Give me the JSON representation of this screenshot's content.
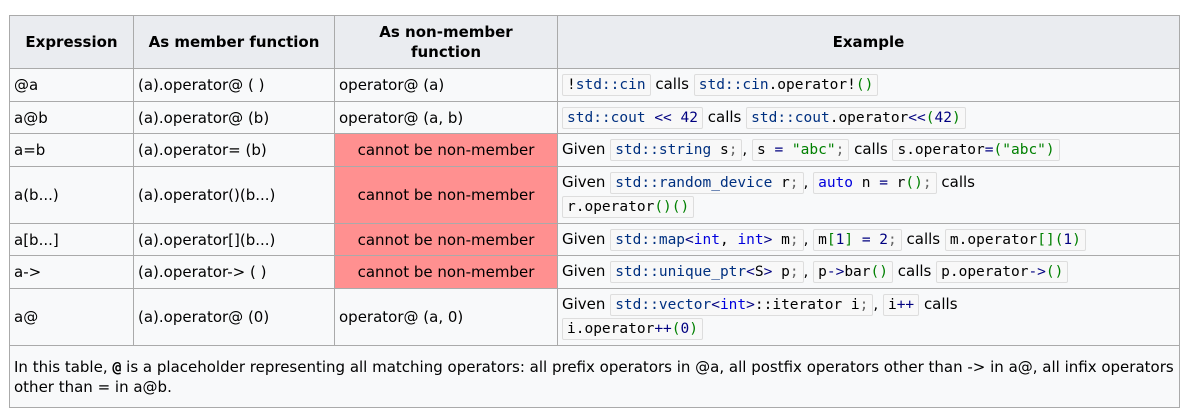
{
  "headers": {
    "expression": "Expression",
    "member": "As member function",
    "nonmember": "As non-member function",
    "example": "Example"
  },
  "rows": [
    {
      "expr": "@a",
      "member": "(a).operator@ ( )",
      "nonmember": "operator@ (a)"
    },
    {
      "expr": "a@b",
      "member": "(a).operator@ (b)",
      "nonmember": "operator@ (a, b)"
    },
    {
      "expr": "a=b",
      "member": "(a).operator= (b)",
      "nonmember": "cannot be non-member"
    },
    {
      "expr": "a(b...)",
      "member": "(a).operator()(b...)",
      "nonmember": "cannot be non-member"
    },
    {
      "expr": "a[b...]",
      "member": "(a).operator[](b...)",
      "nonmember": "cannot be non-member"
    },
    {
      "expr": "a->",
      "member": "(a).operator-> ( )",
      "nonmember": "cannot be non-member"
    },
    {
      "expr": "a@",
      "member": "(a).operator@ (0)",
      "nonmember": "operator@ (a, 0)"
    }
  ],
  "words": {
    "calls": "calls",
    "given": "Given",
    "comma": ","
  },
  "note": {
    "before": "In this table, ",
    "symbol": "@",
    "after": " is a placeholder representing all matching operators: all prefix operators in @a, all postfix operators other than -> in a@, all infix operators other than = in a@b."
  },
  "colors": {
    "cannot_be_nonmember": "#ff9090",
    "header_bg": "#eaecf0",
    "cell_bg": "#f8f9fa"
  }
}
